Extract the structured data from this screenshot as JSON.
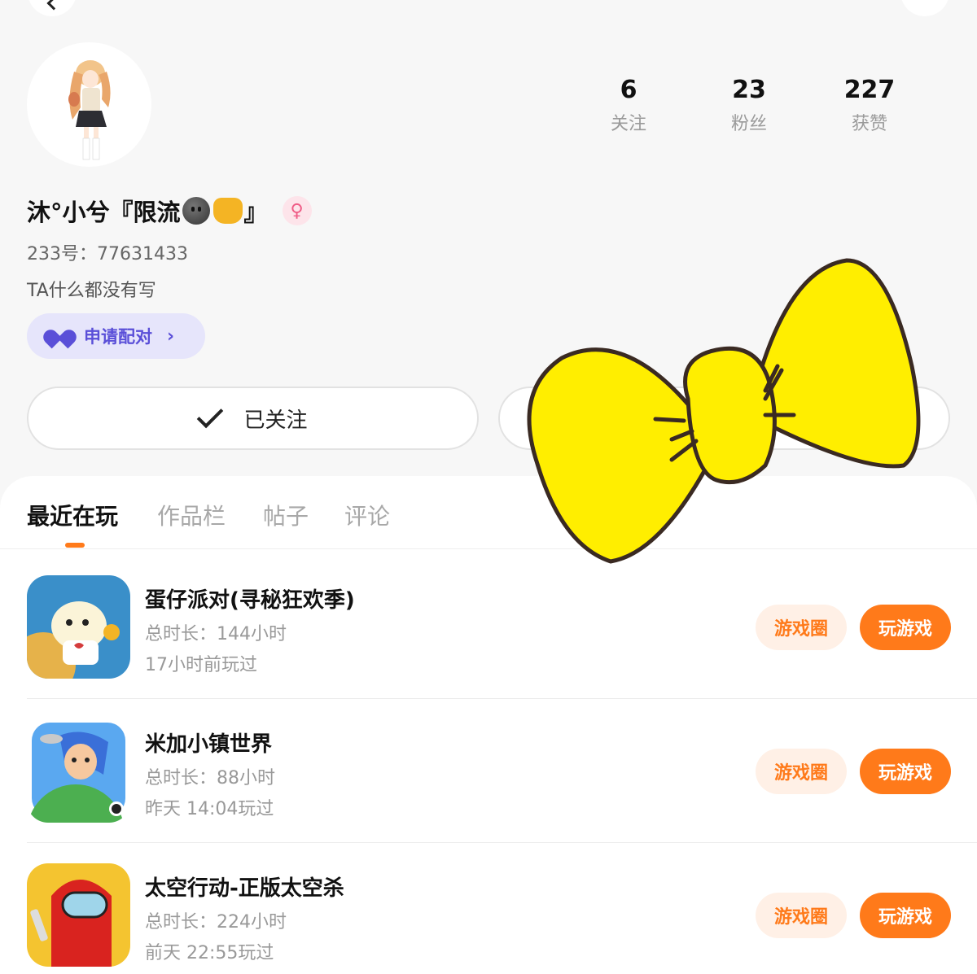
{
  "profile": {
    "nickname": "沐°小兮『限流",
    "nickname_end": "』",
    "gender_symbol": "♀",
    "id_line": "233号：77631433",
    "bio": "TA什么都没有写",
    "pair_label": "申请配对",
    "follow_label": "已关注"
  },
  "stats": [
    {
      "value": "6",
      "label": "关注"
    },
    {
      "value": "23",
      "label": "粉丝"
    },
    {
      "value": "227",
      "label": "获赞"
    }
  ],
  "tabs": [
    {
      "label": "最近在玩",
      "active": true
    },
    {
      "label": "作品栏",
      "active": false
    },
    {
      "label": "帖子",
      "active": false
    },
    {
      "label": "评论",
      "active": false
    }
  ],
  "games": [
    {
      "title": "蛋仔派对(寻秘狂欢季)",
      "duration": "总时长：144小时",
      "last_played": "17小时前玩过",
      "circle_label": "游戏圈",
      "play_label": "玩游戏"
    },
    {
      "title": "米加小镇世界",
      "duration": "总时长：88小时",
      "last_played": "昨天 14:04玩过",
      "circle_label": "游戏圈",
      "play_label": "玩游戏"
    },
    {
      "title": "太空行动-正版太空杀",
      "duration": "总时长：224小时",
      "last_played": "前天 22:55玩过",
      "circle_label": "游戏圈",
      "play_label": "玩游戏"
    }
  ],
  "colors": {
    "accent": "#ff7a1a",
    "pair_purple": "#5a4fd8",
    "bow_yellow": "#ffee00"
  }
}
